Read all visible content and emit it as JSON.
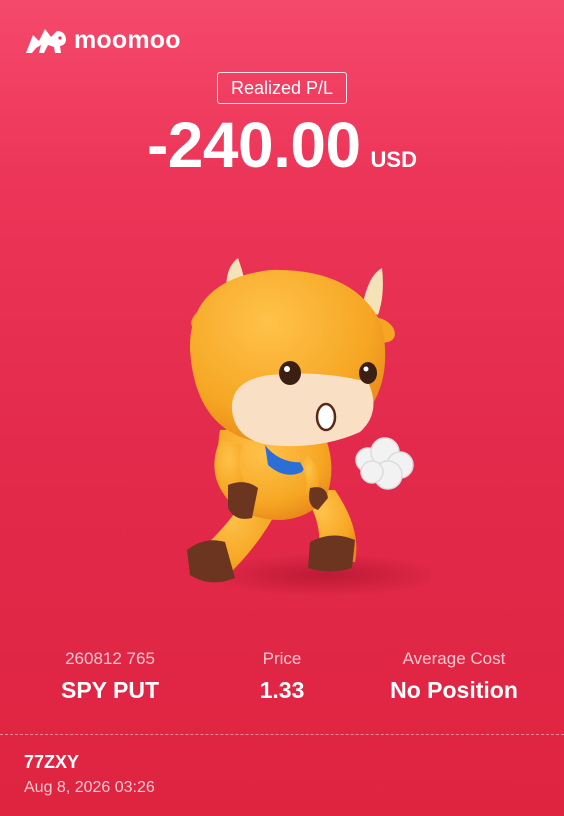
{
  "brand": {
    "name": "moomoo",
    "logo_icon": "bull-logo-icon"
  },
  "summary": {
    "label": "Realized P/L",
    "amount": "-240.00",
    "currency": "USD"
  },
  "illustration": {
    "icon": "bull-mascot-icon",
    "colors": {
      "body": "#f6a623",
      "muzzle": "#f9e0c4",
      "hoof": "#6b3520",
      "scarf": "#2b6fd6"
    }
  },
  "stats": [
    {
      "label": "260812 765",
      "value": "SPY PUT"
    },
    {
      "label": "Price",
      "value": "1.33"
    },
    {
      "label": "Average Cost",
      "value": "No Position"
    }
  ],
  "footer": {
    "user": "77ZXY",
    "timestamp": "Aug 8, 2026 03:26"
  },
  "colors": {
    "background_top": "#f5496b",
    "background_bottom": "#df2440",
    "text": "#ffffff"
  }
}
